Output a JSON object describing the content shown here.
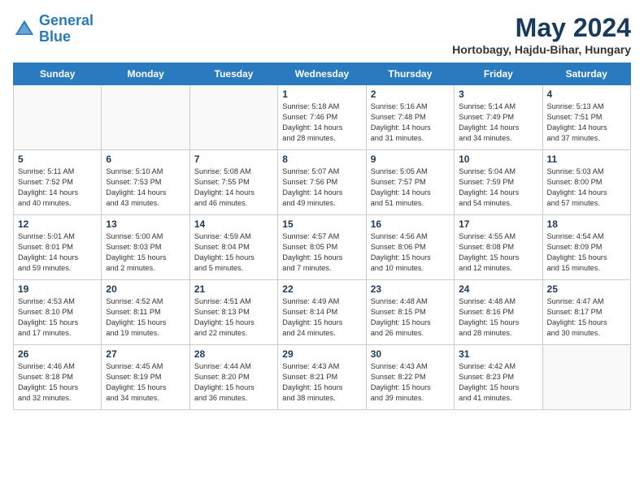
{
  "header": {
    "logo_line1": "General",
    "logo_line2": "Blue",
    "title": "May 2024",
    "location": "Hortobagy, Hajdu-Bihar, Hungary"
  },
  "days_of_week": [
    "Sunday",
    "Monday",
    "Tuesday",
    "Wednesday",
    "Thursday",
    "Friday",
    "Saturday"
  ],
  "weeks": [
    [
      {
        "day": "",
        "info": ""
      },
      {
        "day": "",
        "info": ""
      },
      {
        "day": "",
        "info": ""
      },
      {
        "day": "1",
        "info": "Sunrise: 5:18 AM\nSunset: 7:46 PM\nDaylight: 14 hours\nand 28 minutes."
      },
      {
        "day": "2",
        "info": "Sunrise: 5:16 AM\nSunset: 7:48 PM\nDaylight: 14 hours\nand 31 minutes."
      },
      {
        "day": "3",
        "info": "Sunrise: 5:14 AM\nSunset: 7:49 PM\nDaylight: 14 hours\nand 34 minutes."
      },
      {
        "day": "4",
        "info": "Sunrise: 5:13 AM\nSunset: 7:51 PM\nDaylight: 14 hours\nand 37 minutes."
      }
    ],
    [
      {
        "day": "5",
        "info": "Sunrise: 5:11 AM\nSunset: 7:52 PM\nDaylight: 14 hours\nand 40 minutes."
      },
      {
        "day": "6",
        "info": "Sunrise: 5:10 AM\nSunset: 7:53 PM\nDaylight: 14 hours\nand 43 minutes."
      },
      {
        "day": "7",
        "info": "Sunrise: 5:08 AM\nSunset: 7:55 PM\nDaylight: 14 hours\nand 46 minutes."
      },
      {
        "day": "8",
        "info": "Sunrise: 5:07 AM\nSunset: 7:56 PM\nDaylight: 14 hours\nand 49 minutes."
      },
      {
        "day": "9",
        "info": "Sunrise: 5:05 AM\nSunset: 7:57 PM\nDaylight: 14 hours\nand 51 minutes."
      },
      {
        "day": "10",
        "info": "Sunrise: 5:04 AM\nSunset: 7:59 PM\nDaylight: 14 hours\nand 54 minutes."
      },
      {
        "day": "11",
        "info": "Sunrise: 5:03 AM\nSunset: 8:00 PM\nDaylight: 14 hours\nand 57 minutes."
      }
    ],
    [
      {
        "day": "12",
        "info": "Sunrise: 5:01 AM\nSunset: 8:01 PM\nDaylight: 14 hours\nand 59 minutes."
      },
      {
        "day": "13",
        "info": "Sunrise: 5:00 AM\nSunset: 8:03 PM\nDaylight: 15 hours\nand 2 minutes."
      },
      {
        "day": "14",
        "info": "Sunrise: 4:59 AM\nSunset: 8:04 PM\nDaylight: 15 hours\nand 5 minutes."
      },
      {
        "day": "15",
        "info": "Sunrise: 4:57 AM\nSunset: 8:05 PM\nDaylight: 15 hours\nand 7 minutes."
      },
      {
        "day": "16",
        "info": "Sunrise: 4:56 AM\nSunset: 8:06 PM\nDaylight: 15 hours\nand 10 minutes."
      },
      {
        "day": "17",
        "info": "Sunrise: 4:55 AM\nSunset: 8:08 PM\nDaylight: 15 hours\nand 12 minutes."
      },
      {
        "day": "18",
        "info": "Sunrise: 4:54 AM\nSunset: 8:09 PM\nDaylight: 15 hours\nand 15 minutes."
      }
    ],
    [
      {
        "day": "19",
        "info": "Sunrise: 4:53 AM\nSunset: 8:10 PM\nDaylight: 15 hours\nand 17 minutes."
      },
      {
        "day": "20",
        "info": "Sunrise: 4:52 AM\nSunset: 8:11 PM\nDaylight: 15 hours\nand 19 minutes."
      },
      {
        "day": "21",
        "info": "Sunrise: 4:51 AM\nSunset: 8:13 PM\nDaylight: 15 hours\nand 22 minutes."
      },
      {
        "day": "22",
        "info": "Sunrise: 4:49 AM\nSunset: 8:14 PM\nDaylight: 15 hours\nand 24 minutes."
      },
      {
        "day": "23",
        "info": "Sunrise: 4:48 AM\nSunset: 8:15 PM\nDaylight: 15 hours\nand 26 minutes."
      },
      {
        "day": "24",
        "info": "Sunrise: 4:48 AM\nSunset: 8:16 PM\nDaylight: 15 hours\nand 28 minutes."
      },
      {
        "day": "25",
        "info": "Sunrise: 4:47 AM\nSunset: 8:17 PM\nDaylight: 15 hours\nand 30 minutes."
      }
    ],
    [
      {
        "day": "26",
        "info": "Sunrise: 4:46 AM\nSunset: 8:18 PM\nDaylight: 15 hours\nand 32 minutes."
      },
      {
        "day": "27",
        "info": "Sunrise: 4:45 AM\nSunset: 8:19 PM\nDaylight: 15 hours\nand 34 minutes."
      },
      {
        "day": "28",
        "info": "Sunrise: 4:44 AM\nSunset: 8:20 PM\nDaylight: 15 hours\nand 36 minutes."
      },
      {
        "day": "29",
        "info": "Sunrise: 4:43 AM\nSunset: 8:21 PM\nDaylight: 15 hours\nand 38 minutes."
      },
      {
        "day": "30",
        "info": "Sunrise: 4:43 AM\nSunset: 8:22 PM\nDaylight: 15 hours\nand 39 minutes."
      },
      {
        "day": "31",
        "info": "Sunrise: 4:42 AM\nSunset: 8:23 PM\nDaylight: 15 hours\nand 41 minutes."
      },
      {
        "day": "",
        "info": ""
      }
    ]
  ]
}
